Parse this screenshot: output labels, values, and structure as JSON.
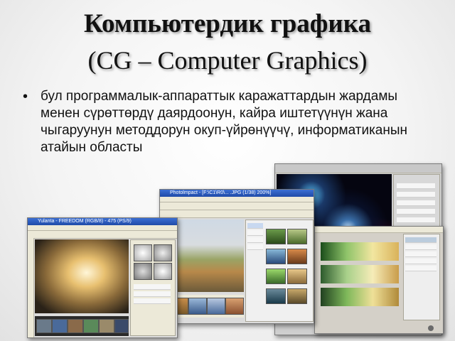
{
  "slide": {
    "title_line1": "Компьютердик графика",
    "title_line2": "(CG – Computer Graphics)",
    "bullet_symbol": "•",
    "bullet_text": "бул программалык-аппараттык каражаттардын жардамы менен сүрөттөрдү даярдоонун, кайра иштетүүнүн жана чыгаруунун методдорун окуп-үйрөнүүчү, информатиканын атайын областы"
  },
  "screens": {
    "left_title": "Yulanta - FREEDOM (RGB/8) - 475 (PS/9)",
    "middle_title": "Photolmpact - [F:\\C1\\R0\\... .JPG (1/38) 200%]"
  },
  "colors": {
    "accent": "#1f4aa8",
    "text": "#111111"
  }
}
